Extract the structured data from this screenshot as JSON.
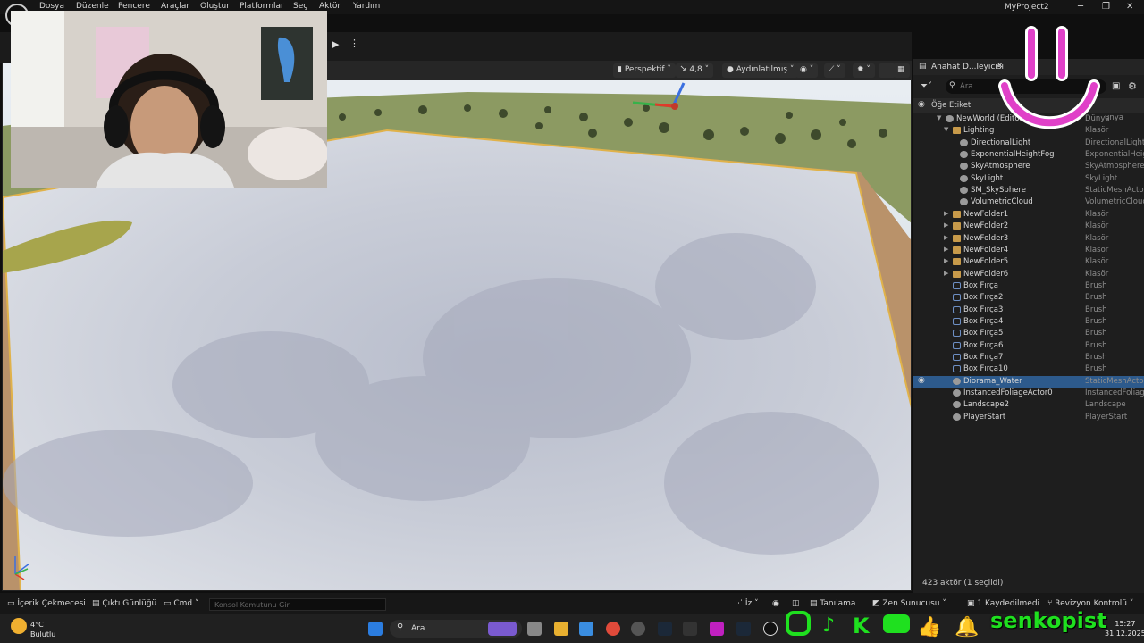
{
  "menu": [
    "Dosya",
    "Düzenle",
    "Pencere",
    "Araçlar",
    "Oluştur",
    "Platformlar",
    "Seç",
    "Aktör",
    "Yardım"
  ],
  "project_title": "MyProject2",
  "window_controls": [
    "─",
    "❐",
    "✕"
  ],
  "viewport": {
    "perspective_label": "Perspektif",
    "camera_speed": "4,8",
    "lighting_label": "Aydınlatılmış"
  },
  "outliner": {
    "tab_label": "Anahat D...leyicisi",
    "search_placeholder": "Ara",
    "column_label": "Öğe Etiketi",
    "type_column_partial": "unya",
    "status": "423 aktör (1 seçildi)",
    "rows": [
      {
        "name": "NewWorld (Editör)",
        "type": "Dünya",
        "indent": 0,
        "icon": "world"
      },
      {
        "name": "Lighting",
        "type": "Klasör",
        "indent": 1,
        "icon": "folder"
      },
      {
        "name": "DirectionalLight",
        "type": "DirectionalLight",
        "indent": 2,
        "icon": "actor"
      },
      {
        "name": "ExponentialHeightFog",
        "type": "ExponentialHeig",
        "indent": 2,
        "icon": "actor"
      },
      {
        "name": "SkyAtmosphere",
        "type": "SkyAtmosphere",
        "indent": 2,
        "icon": "actor"
      },
      {
        "name": "SkyLight",
        "type": "SkyLight",
        "indent": 2,
        "icon": "actor"
      },
      {
        "name": "SM_SkySphere",
        "type": "StaticMeshActor",
        "indent": 2,
        "icon": "actor"
      },
      {
        "name": "VolumetricCloud",
        "type": "VolumetricCloud",
        "indent": 2,
        "icon": "actor"
      },
      {
        "name": "NewFolder1",
        "type": "Klasör",
        "indent": 1,
        "icon": "folder"
      },
      {
        "name": "NewFolder2",
        "type": "Klasör",
        "indent": 1,
        "icon": "folder"
      },
      {
        "name": "NewFolder3",
        "type": "Klasör",
        "indent": 1,
        "icon": "folder"
      },
      {
        "name": "NewFolder4",
        "type": "Klasör",
        "indent": 1,
        "icon": "folder"
      },
      {
        "name": "NewFolder5",
        "type": "Klasör",
        "indent": 1,
        "icon": "folder"
      },
      {
        "name": "NewFolder6",
        "type": "Klasör",
        "indent": 1,
        "icon": "folder"
      },
      {
        "name": "Box Fırça",
        "type": "Brush",
        "indent": 1,
        "icon": "brush"
      },
      {
        "name": "Box Fırça2",
        "type": "Brush",
        "indent": 1,
        "icon": "brush"
      },
      {
        "name": "Box Fırça3",
        "type": "Brush",
        "indent": 1,
        "icon": "brush"
      },
      {
        "name": "Box Fırça4",
        "type": "Brush",
        "indent": 1,
        "icon": "brush"
      },
      {
        "name": "Box Fırça5",
        "type": "Brush",
        "indent": 1,
        "icon": "brush"
      },
      {
        "name": "Box Fırça6",
        "type": "Brush",
        "indent": 1,
        "icon": "brush"
      },
      {
        "name": "Box Fırça7",
        "type": "Brush",
        "indent": 1,
        "icon": "brush"
      },
      {
        "name": "Box Fırça10",
        "type": "Brush",
        "indent": 1,
        "icon": "brush"
      },
      {
        "name": "Diorama_Water",
        "type": "StaticMeshActor",
        "indent": 1,
        "icon": "actor",
        "selected": true
      },
      {
        "name": "InstancedFoliageActor0",
        "type": "InstancedFoliage",
        "indent": 1,
        "icon": "actor"
      },
      {
        "name": "Landscape2",
        "type": "Landscape",
        "indent": 1,
        "icon": "actor"
      },
      {
        "name": "PlayerStart",
        "type": "PlayerStart",
        "indent": 1,
        "icon": "actor"
      }
    ]
  },
  "bottom_bar": {
    "content_drawer": "İçerik Çekmecesi",
    "output_log": "Çıktı Günlüğü",
    "cmd": "Cmd",
    "console_placeholder": "Konsol Komutunu Gir",
    "trace": "İz",
    "diagnostics": "Tanılama",
    "zen_server": "Zen Sunucusu",
    "unsaved": "1 Kaydedilmedi",
    "revision": "Revizyon Kontrolü"
  },
  "taskbar": {
    "weather_temp": "4°C",
    "weather_desc": "Bulutlu",
    "search_label": "Ara",
    "time": "15:27",
    "date": "31.12.2025"
  },
  "overlay": {
    "channel_name": "senkopist",
    "smile_color": "#e040c8",
    "social_color": "#1fe01f"
  }
}
